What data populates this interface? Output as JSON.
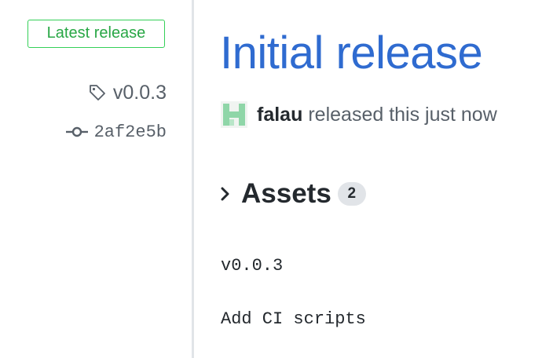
{
  "sidebar": {
    "badge_label": "Latest release",
    "tag": "v0.0.3",
    "commit": "2af2e5b"
  },
  "release": {
    "title": "Initial release",
    "author": "falau",
    "released_text": "released this just now",
    "assets_label": "Assets",
    "assets_count": "2",
    "body_lines": [
      "v0.0.3",
      "Add CI scripts"
    ]
  },
  "colors": {
    "link_blue": "#2f6bd0",
    "badge_green": "#28a745",
    "muted": "#586069",
    "avatar_green": "#8fd6a8"
  }
}
